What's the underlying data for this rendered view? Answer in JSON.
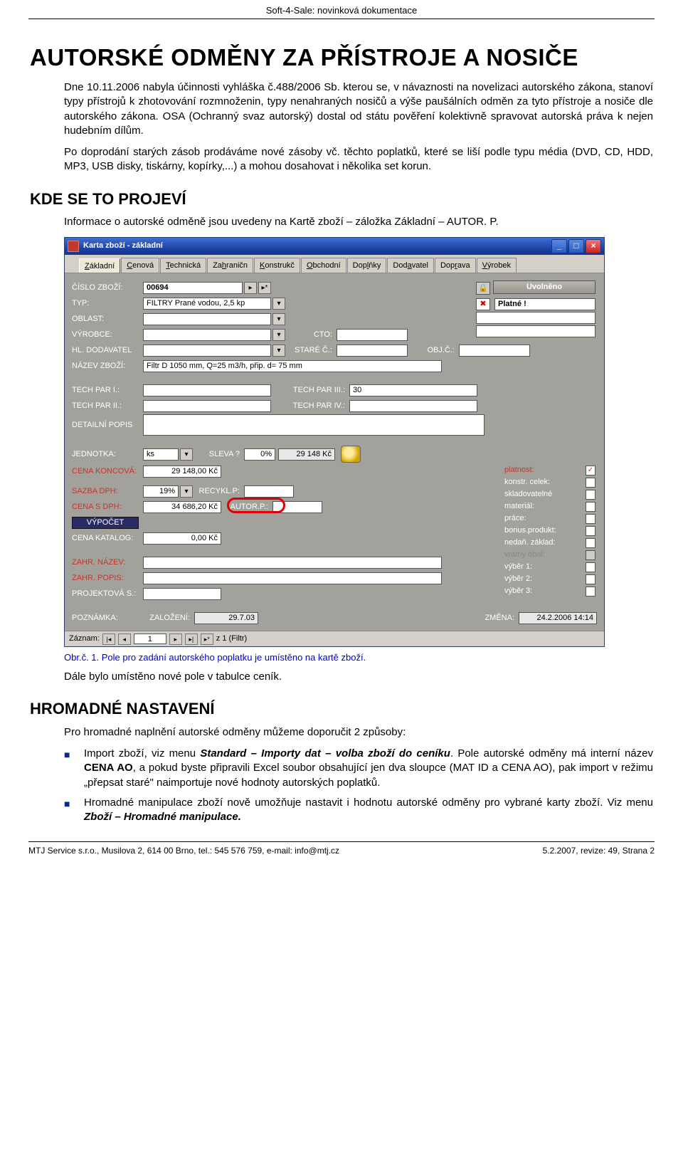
{
  "header": "Soft-4-Sale: novinková dokumentace",
  "title": "AUTORSKÉ ODMĚNY ZA PŘÍSTROJE A NOSIČE",
  "intro": "Dne 10.11.2006 nabyla účinnosti vyhláška č.488/2006 Sb. kterou se, v návaznosti na novelizaci autorského zákona, stanoví typy přístrojů k zhotovování rozmnoženin, typy nenahraných nosičů a výše paušálních odměn za tyto přístroje a nosiče dle autorského zákona. OSA (Ochranný svaz autorský) dostal od státu pověření kolektivně spravovat autorská práva k nejen hudebním dílům.",
  "intro2": "Po doprodání starých zásob prodáváme nové zásoby vč. těchto poplatků, které se liší podle typu média (DVD, CD, HDD, MP3, USB disky, tiskárny, kopírky,...) a mohou dosahovat i několika set korun.",
  "h2a": "KDE SE TO PROJEVÍ",
  "kde_text": "Informace o autorské odměně jsou uvedeny na Kartě zboží – záložka Základní – AUTOR. P.",
  "caption1": "Obr.č. 1. Pole pro zadání autorského poplatku je umístěno na kartě zboží.",
  "after_img": "Dále bylo umístěno nové pole v tabulce ceník.",
  "h2b": "HROMADNÉ NASTAVENÍ",
  "hrom_intro": "Pro hromadné naplnění autorské odměny můžeme doporučit 2 způsoby:",
  "bullet1_pre": "Import zboží, viz menu ",
  "bullet1_bold": "Standard – Importy dat – volba zboží do ceníku",
  "bullet1_post": ". Pole autorské odměny má interní název ",
  "bullet1_bold2": "CENA AO",
  "bullet1_post2": ", a pokud byste připravili Excel soubor obsahující jen dva sloupce (MAT ID a CENA AO), pak import v režimu „přepsat staré\" naimportuje nové hodnoty autorských poplatků.",
  "bullet2_pre": "Hromadné manipulace zboží nově umožňuje nastavit i hodnotu autorské odměny pro vybrané karty zboží. Viz menu ",
  "bullet2_bold": "Zboží – Hromadné manipulace.",
  "footer_left": "MTJ Service s.r.o., Musilova 2, 614 00 Brno, tel.: 545 576 759, e-mail: info@mtj.cz",
  "footer_right": "5.2.2007, revize: 49, Strana 2",
  "win": {
    "title": "Karta zboží - základní",
    "tabs": [
      "Základní",
      "Cenová",
      "Technická",
      "Zahraničn",
      "Konstrukč",
      "Obchodní",
      "Doplňky",
      "Dodavatel",
      "Doprava",
      "Výrobek"
    ],
    "labels": {
      "cislo": "ČÍSLO ZBOŽÍ:",
      "typ": "TYP:",
      "oblast": "OBLAST:",
      "vyrobce": "VÝROBCE:",
      "hldod": "HL. DODAVATEL",
      "nazev": "NÁZEV ZBOŽÍ:",
      "tp1": "TECH PAR I.:",
      "tp2": "TECH PAR II.:",
      "tp3": "TECH PAR III.:",
      "tp4": "TECH PAR IV.:",
      "detail": "DETAILNÍ POPIS",
      "jednotka": "JEDNOTKA:",
      "sleva": "SLEVA ?",
      "koncova": "CENA KONCOVÁ:",
      "dph": "SAZBA DPH:",
      "recykl": "RECYKL.P:",
      "sdph": "CENA S DPH:",
      "autor": "AUTOR.P.:",
      "vypocet": "VÝPOČET",
      "katalog": "CENA KATALOG:",
      "zn": "ZAHR. NÁZEV:",
      "zp": "ZAHR. POPIS:",
      "proj": "PROJEKTOVÁ S.:",
      "pozn": "POZNÁMKA:",
      "zaloz": "ZALOŽENÍ:",
      "zmena": "ZMĚNA:",
      "cto": "CTO:",
      "stare": "STARÉ Č.:",
      "objc": "OBJ.Č.:",
      "uvolneno": "Uvolněno",
      "platne": "Platné !",
      "platnost": "platnost:",
      "kcelek": "konstr. celek:",
      "sklad": "skladovatelné",
      "material": "materiál:",
      "prace": "práce:",
      "bonus": "bonus.produkt:",
      "nedan": "nedaň. základ:",
      "vratny": "vratný obal:",
      "v1": "výběr 1:",
      "v2": "výběr 2:",
      "v3": "výběr 3:",
      "zaznam": "Záznam:",
      "zfiltr": "z 1 (Filtr)"
    },
    "vals": {
      "cislo": "00694",
      "typ": "FILTRY Prané vodou, 2,5 kp",
      "nazev": "Filtr D 1050 mm, Q=25 m3/h, přip. d= 75 mm",
      "tp3": "30",
      "jednotka": "ks",
      "sleva": "0%",
      "sleva_kc": "29 148 Kč",
      "koncova": "29 148,00 Kč",
      "dph": "19%",
      "sdph": "34 686,20 Kč",
      "katalog": "0,00 Kč",
      "zaloz": "29.7.03",
      "zmena": "24.2.2006 14:14",
      "rec": "1"
    }
  }
}
